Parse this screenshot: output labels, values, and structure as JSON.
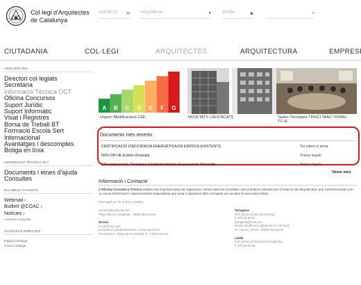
{
  "header": {
    "org_name_line1": "Col·legi d'Arquitectes",
    "org_name_line2": "de Catalunya",
    "contact_label": "CONTACTE",
    "login_label": "HOLA MARTA",
    "language_label": "IDIOMA"
  },
  "nav": {
    "items": [
      "CIUTADANIA",
      "COL·LEGI",
      "ARQUITECTES",
      "ARQUITECTURA",
      "EMPRESES"
    ]
  },
  "sidebar": {
    "arquitectes_heading": "ARQUITECTES",
    "links": [
      "Directori col·legiats",
      "Secretaria",
      "Informació Tècnica OCT",
      "Oficina Concursos",
      "Suport Jurídic",
      "Suport Informàtic",
      "Visat i Registres",
      "Borsa de Treball BT",
      "Formació Escola Sert",
      "Internacional",
      "Avantatges i descomptes",
      "Botiga en línia"
    ],
    "tecnica_heading": "INFORMACIÓ TÈCNICA OCT",
    "tecnica_links": [
      "Documents i eines d'ajuda",
      "Consultes"
    ],
    "favorits_heading": "ELS MEUS FAVORITS",
    "favorits_links": [
      "Webmail ›",
      "Butlletí @COAC ›",
      "Notícies ›"
    ],
    "add_favorite": "▪ Incloure a favorits",
    "directes_heading": "ACCESSOS DIRECTES",
    "directes_links": [
      "Intègra contingut",
      "Cerca contingut"
    ]
  },
  "thumbs": {
    "energy_letters": [
      "A",
      "B",
      "C",
      "D",
      "E",
      "F",
      "G"
    ],
    "energy_colors": [
      "#1a9641",
      "#52b151",
      "#a6d96a",
      "#d4e157",
      "#fdae61",
      "#f46d43",
      "#d7191c"
    ],
    "caption1": "Urgent: Modificacions CEE",
    "caption2": "NOVETATS i DESTACATS",
    "caption4_line1": "Taules Tècniques TINSCI TAAC TIOPAU",
    "caption4_line2": "TC-IE"
  },
  "docs": {
    "title": "Documents més recents",
    "rows": [
      {
        "title": "CERTIFICACIÓ D'EFICIÈNCIA ENERGÈTICA EN EDIFICIS EXISTENTS",
        "category": "Tot sobre el tema"
      },
      {
        "title": "NOU DB HE Estalvi d'energia",
        "category": "Textos legals"
      },
      {
        "title": "SPs Instruccions Tècniques Complementàries de prevenció d'incendis",
        "category": "Textos legals"
      }
    ],
    "more_label": "Veure més"
  },
  "info": {
    "title": "Informació i Contacte",
    "text_bold": "L'Oficina Consultora Tècnica",
    "text_rest": " realitza una important tasca de seguiment i revisió sobre la normativa i documentació rellevant per a l'exercici de l'arquitectura, que li permet actuar com un servei d'informació i assessorament especialitzat que posa a disposició dels col·legiats per recolzar la seva tasca diària.",
    "consult_link": "Clica aquí per fer la teva consulta",
    "email_bcn": "octconsultes@coac.net",
    "address_bcn": "Plaça Nova 5, 4a planta · 08002 Barcelona",
    "girona_title": "Girona",
    "girona_email": "oct.gi@coac.net",
    "girona_line1": "Consultes exclusivament per correu electrònic",
    "girona_line2": "Pia Almoina - Plaça de la Catedral, 8 - 17004 Girona",
    "tarragona_title": "Tarragona",
    "tarragona_line1": "SAT (Servei d'Atenció tècnica)",
    "tarragona_phone": "T. 977 24 93 67",
    "tarragona_email": "tarragona@coac.net",
    "tarragona_hours": "Horari: de dilluns a dijous de 8 a 15 hores",
    "tarragona_address": "St. Llorenç, 20-22 - 43003 Tarragona",
    "lleida_title": "Lleida",
    "lleida_line1": "SAT (Servei d'Atenció a l'Arquitecte)",
    "lleida_phone": "T. 973 22 89 36"
  }
}
